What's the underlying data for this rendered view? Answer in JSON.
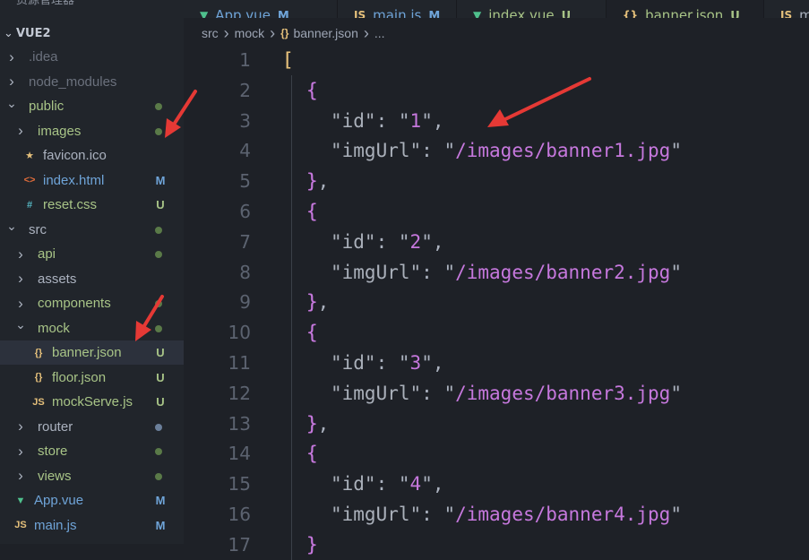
{
  "sidebar": {
    "header": "资源管理器",
    "root_label": "VUE2",
    "items": [
      {
        "name": ".idea",
        "kind": "folder",
        "open": false,
        "depth": 1,
        "color": "dim",
        "badge": "",
        "dot": ""
      },
      {
        "name": "node_modules",
        "kind": "folder",
        "open": false,
        "depth": 1,
        "color": "dim",
        "badge": "",
        "dot": ""
      },
      {
        "name": "public",
        "kind": "folder",
        "open": true,
        "depth": 1,
        "color": "green",
        "badge": "",
        "dot": "#5a7a48"
      },
      {
        "name": "images",
        "kind": "folder",
        "open": false,
        "depth": 2,
        "color": "green",
        "badge": "",
        "dot": "#5a7a48"
      },
      {
        "name": "favicon.ico",
        "kind": "file",
        "icon": "star",
        "depth": 2,
        "color": "norm",
        "badge": "",
        "dot": ""
      },
      {
        "name": "index.html",
        "kind": "file",
        "icon": "html",
        "depth": 2,
        "color": "mod",
        "badge": "M",
        "dot": ""
      },
      {
        "name": "reset.css",
        "kind": "file",
        "icon": "css",
        "depth": 2,
        "color": "green",
        "badge": "U",
        "dot": ""
      },
      {
        "name": "src",
        "kind": "folder",
        "open": true,
        "depth": 1,
        "color": "norm",
        "badge": "",
        "dot": "#5a7a48"
      },
      {
        "name": "api",
        "kind": "folder",
        "open": false,
        "depth": 2,
        "color": "green",
        "badge": "",
        "dot": "#5a7a48"
      },
      {
        "name": "assets",
        "kind": "folder",
        "open": false,
        "depth": 2,
        "color": "norm",
        "badge": "",
        "dot": ""
      },
      {
        "name": "components",
        "kind": "folder",
        "open": false,
        "depth": 2,
        "color": "green",
        "badge": "",
        "dot": "#5a7a48"
      },
      {
        "name": "mock",
        "kind": "folder",
        "open": true,
        "depth": 2,
        "color": "green",
        "badge": "",
        "dot": "#5a7a48"
      },
      {
        "name": "banner.json",
        "kind": "file",
        "icon": "json",
        "depth": 3,
        "color": "green",
        "badge": "U",
        "dot": "",
        "selected": true
      },
      {
        "name": "floor.json",
        "kind": "file",
        "icon": "json",
        "depth": 3,
        "color": "green",
        "badge": "U",
        "dot": ""
      },
      {
        "name": "mockServe.js",
        "kind": "file",
        "icon": "js",
        "depth": 3,
        "color": "green",
        "badge": "U",
        "dot": ""
      },
      {
        "name": "router",
        "kind": "folder",
        "open": false,
        "depth": 2,
        "color": "norm",
        "badge": "",
        "dot": "#6b7f9a"
      },
      {
        "name": "store",
        "kind": "folder",
        "open": false,
        "depth": 2,
        "color": "green",
        "badge": "",
        "dot": "#5a7a48"
      },
      {
        "name": "views",
        "kind": "folder",
        "open": false,
        "depth": 2,
        "color": "green",
        "badge": "",
        "dot": "#5a7a48"
      },
      {
        "name": "App.vue",
        "kind": "file",
        "icon": "vue",
        "depth": 1,
        "color": "mod",
        "badge": "M",
        "dot": ""
      },
      {
        "name": "main.js",
        "kind": "file",
        "icon": "js",
        "depth": 1,
        "color": "mod",
        "badge": "M",
        "dot": ""
      }
    ]
  },
  "tabs": [
    {
      "icon": "vue",
      "label": "App.vue",
      "badge": "M",
      "color": "mod",
      "active": false
    },
    {
      "icon": "js",
      "label": "main.js",
      "badge": "M",
      "color": "mod",
      "active": false
    },
    {
      "icon": "vue",
      "label": "index.vue",
      "badge": "U",
      "color": "green",
      "active": false
    },
    {
      "icon": "json",
      "label": "banner.json",
      "badge": "U",
      "color": "green",
      "active": true
    },
    {
      "icon": "js",
      "label": "m",
      "badge": "",
      "color": "norm",
      "active": false
    }
  ],
  "breadcrumb": {
    "parts": [
      "src",
      "mock"
    ],
    "file": "banner.json",
    "ellipsis": "..."
  },
  "editor": {
    "lines": [
      {
        "n": "1",
        "text": "["
      },
      {
        "n": "2",
        "text": "{"
      },
      {
        "n": "3",
        "key": "\"id\"",
        "value": "\"1\"",
        "trail": ","
      },
      {
        "n": "4",
        "key": "\"imgUrl\"",
        "value": "\"/images/banner1.jpg\"",
        "trail": ""
      },
      {
        "n": "5",
        "text": "},"
      },
      {
        "n": "6",
        "text": "{"
      },
      {
        "n": "7",
        "key": "\"id\"",
        "value": "\"2\"",
        "trail": ","
      },
      {
        "n": "8",
        "key": "\"imgUrl\"",
        "value": "\"/images/banner2.jpg\"",
        "trail": ""
      },
      {
        "n": "9",
        "text": "},"
      },
      {
        "n": "10",
        "text": "{"
      },
      {
        "n": "11",
        "key": "\"id\"",
        "value": "\"3\"",
        "trail": ","
      },
      {
        "n": "12",
        "key": "\"imgUrl\"",
        "value": "\"/images/banner3.jpg\"",
        "trail": ""
      },
      {
        "n": "13",
        "text": "},"
      },
      {
        "n": "14",
        "text": "{"
      },
      {
        "n": "15",
        "key": "\"id\"",
        "value": "\"4\"",
        "trail": ","
      },
      {
        "n": "16",
        "key": "\"imgUrl\"",
        "value": "\"/images/banner4.jpg\"",
        "trail": ""
      },
      {
        "n": "17",
        "text": "}"
      }
    ]
  },
  "colors": {
    "arrow": "#e53935",
    "bracket_outer": "#e5c07b",
    "bracket_inner": "#c678dd"
  }
}
